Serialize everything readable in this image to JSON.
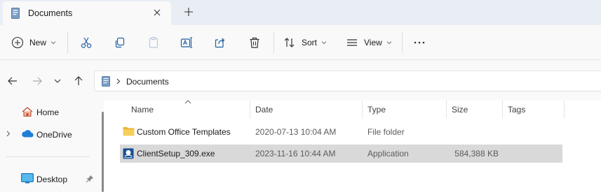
{
  "tab": {
    "title": "Documents"
  },
  "toolbar": {
    "new_label": "New",
    "sort_label": "Sort",
    "view_label": "View"
  },
  "address": {
    "path": "Documents"
  },
  "nav": {
    "items": [
      {
        "label": "Home"
      },
      {
        "label": "OneDrive"
      },
      {
        "label": "Desktop"
      }
    ]
  },
  "columns": [
    "Name",
    "Date",
    "Type",
    "Size",
    "Tags"
  ],
  "files": [
    {
      "name": "Custom Office Templates",
      "date": "2020-07-13 10:04 AM",
      "type": "File folder",
      "size": ""
    },
    {
      "name": "ClientSetup_309.exe",
      "date": "2023-11-16 10:44 AM",
      "type": "Application",
      "size": "584,388 KB"
    }
  ],
  "colors": {
    "folder": "#f0c14b",
    "selection": "#d9d9d9",
    "accent": "#0067c0"
  }
}
